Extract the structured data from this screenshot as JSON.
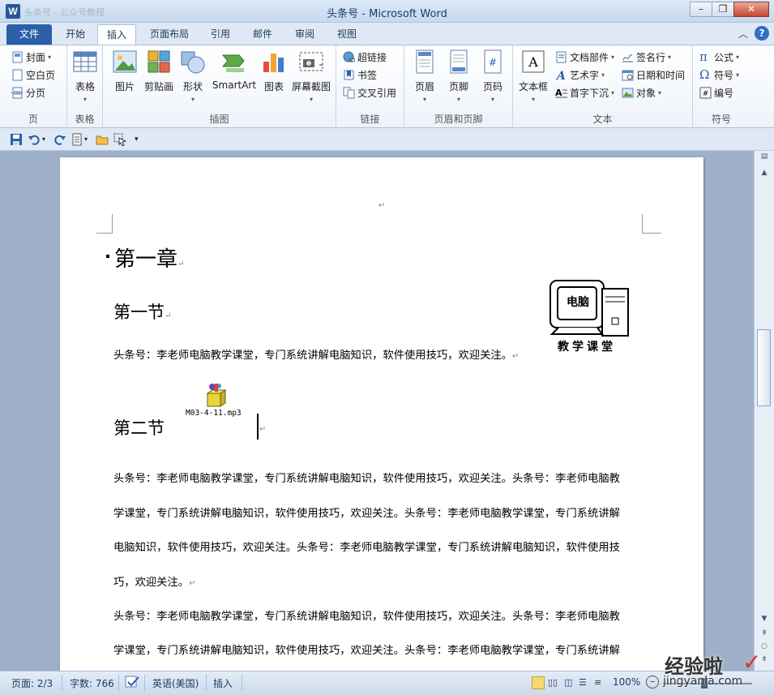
{
  "window": {
    "title": "头条号 - Microsoft Word",
    "app_icon": "W",
    "qat_title": "头条号 - 公众号教程"
  },
  "tabs": {
    "file": "文件",
    "items": [
      "开始",
      "插入",
      "页面布局",
      "引用",
      "邮件",
      "审阅",
      "视图"
    ],
    "active": "插入"
  },
  "ribbon": {
    "pages": {
      "cover": "封面",
      "blank": "空白页",
      "break": "分页",
      "label": "页"
    },
    "table": {
      "button": "表格",
      "label": "表格"
    },
    "illustrations": {
      "picture": "图片",
      "clipart": "剪贴画",
      "shapes": "形状",
      "smartart": "SmartArt",
      "chart": "图表",
      "screenshot": "屏幕截图",
      "label": "插图"
    },
    "links": {
      "hyperlink": "超链接",
      "bookmark": "书签",
      "crossref": "交叉引用",
      "label": "链接"
    },
    "header_footer": {
      "header": "页眉",
      "footer": "页脚",
      "page_number": "页码",
      "label": "页眉和页脚"
    },
    "text": {
      "textbox": "文本框",
      "quickparts": "文档部件",
      "wordart": "艺术字",
      "dropcap": "首字下沉",
      "signature": "签名行",
      "datetime": "日期和时间",
      "object": "对象",
      "label": "文本"
    },
    "symbols": {
      "equation": "公式",
      "symbol": "符号",
      "numbering": "编号",
      "label": "符号"
    }
  },
  "document": {
    "chapter": "第一章",
    "section1": "第一节",
    "section1_text": "头条号：李老师电脑教学课堂，专门系统讲解电脑知识，软件使用技巧，欢迎关注。",
    "attachment": "M03-4-11.mp3",
    "section2": "第二节",
    "para1": [
      "头条号：李老师电脑教学课堂，专门系统讲解电脑知识，软件使用技巧，欢迎关注。头条号：李老师电脑教",
      "学课堂，专门系统讲解电脑知识，软件使用技巧，欢迎关注。头条号：李老师电脑教学课堂，专门系统讲解",
      "电脑知识，软件使用技巧，欢迎关注。头条号：李老师电脑教学课堂，专门系统讲解电脑知识，软件使用技",
      "巧，欢迎关注。"
    ],
    "para2": [
      "头条号：李老师电脑教学课堂，专门系统讲解电脑知识，软件使用技巧，欢迎关注。头条号：李老师电脑教",
      "学课堂，专门系统讲解电脑知识，软件使用技巧，欢迎关注。头条号：李老师电脑教学课堂，专门系统讲解"
    ],
    "logo_screen_text": "电脑",
    "logo_caption": "教学课堂"
  },
  "status": {
    "page": "页面: 2/3",
    "words": "字数: 766",
    "language": "英语(美国)",
    "mode": "插入",
    "zoom": "100%"
  },
  "watermark": {
    "line1": "经验啦",
    "line2": "jingyanla.com",
    "check": "✓"
  },
  "colors": {
    "accent": "#2b5fa8",
    "file_tab": "#2b5fa8",
    "close": "#c8452b"
  }
}
